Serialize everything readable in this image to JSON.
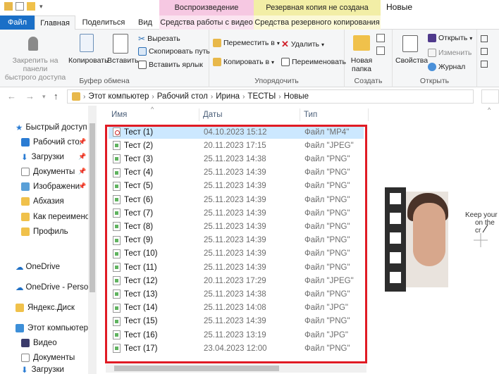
{
  "title_bar": {
    "window_title": "Новые",
    "context_play": "Воспроизведение",
    "context_backup": "Резервная копия не создана"
  },
  "tabs": [
    "Файл",
    "Главная",
    "Поделиться",
    "Вид",
    "Средства работы с видео",
    "Средства резервного копирования"
  ],
  "ribbon": {
    "pin": "Закрепить на панели быстрого доступа",
    "pin_l1": "Закрепить на панели",
    "pin_l2": "быстрого доступа",
    "copy": "Копировать",
    "paste": "Вставить",
    "cut": "Вырезать",
    "copy_path": "Скопировать путь",
    "paste_shortcut": "Вставить ярлык",
    "clipboard_group": "Буфер обмена",
    "move_to": "Переместить в",
    "copy_to": "Копировать в",
    "delete": "Удалить",
    "rename": "Переименовать",
    "organize_group": "Упорядочить",
    "new_folder_l1": "Новая",
    "new_folder_l2": "папка",
    "create_group": "Создать",
    "properties": "Свойства",
    "open": "Открыть",
    "edit": "Изменить",
    "history": "Журнал",
    "open_group": "Открыть"
  },
  "address": {
    "crumbs": [
      "Этот компьютер",
      "Рабочий стол",
      "Ирина",
      "ТЕСТЫ",
      "Новые"
    ]
  },
  "nav": [
    {
      "label": "Быстрый доступ",
      "pinned": false
    },
    {
      "label": "Рабочий сто.",
      "pinned": true
    },
    {
      "label": "Загрузки",
      "pinned": true
    },
    {
      "label": "Документы",
      "pinned": true
    },
    {
      "label": "Изображени",
      "pinned": true
    },
    {
      "label": "Абхазия",
      "pinned": false
    },
    {
      "label": "Как переимено",
      "pinned": false
    },
    {
      "label": "Профиль",
      "pinned": false
    },
    {
      "label": "OneDrive",
      "pinned": false
    },
    {
      "label": "OneDrive - Person",
      "pinned": false
    },
    {
      "label": "Яндекс.Диск",
      "pinned": false
    },
    {
      "label": "Этот компьютер",
      "pinned": false
    },
    {
      "label": "Видео",
      "pinned": false
    },
    {
      "label": "Документы",
      "pinned": false
    },
    {
      "label": "Загрузки",
      "pinned": false
    }
  ],
  "columns": {
    "name": "Имя",
    "date": "Даты",
    "type": "Тип"
  },
  "files": [
    {
      "name": "Тест (1)",
      "date": "04.10.2023 15:12",
      "type": "Файл \"MP4\"",
      "kind": "mp4",
      "selected": true
    },
    {
      "name": "Тест (2)",
      "date": "20.11.2023 17:15",
      "type": "Файл \"JPEG\"",
      "kind": "png",
      "selected": false
    },
    {
      "name": "Тест (3)",
      "date": "25.11.2023 14:38",
      "type": "Файл \"PNG\"",
      "kind": "png",
      "selected": false
    },
    {
      "name": "Тест (4)",
      "date": "25.11.2023 14:39",
      "type": "Файл \"PNG\"",
      "kind": "png",
      "selected": false
    },
    {
      "name": "Тест (5)",
      "date": "25.11.2023 14:39",
      "type": "Файл \"PNG\"",
      "kind": "png",
      "selected": false
    },
    {
      "name": "Тест (6)",
      "date": "25.11.2023 14:39",
      "type": "Файл \"PNG\"",
      "kind": "png",
      "selected": false
    },
    {
      "name": "Тест (7)",
      "date": "25.11.2023 14:39",
      "type": "Файл \"PNG\"",
      "kind": "png",
      "selected": false
    },
    {
      "name": "Тест (8)",
      "date": "25.11.2023 14:39",
      "type": "Файл \"PNG\"",
      "kind": "png",
      "selected": false
    },
    {
      "name": "Тест (9)",
      "date": "25.11.2023 14:39",
      "type": "Файл \"PNG\"",
      "kind": "png",
      "selected": false
    },
    {
      "name": "Тест (10)",
      "date": "25.11.2023 14:39",
      "type": "Файл \"PNG\"",
      "kind": "png",
      "selected": false
    },
    {
      "name": "Тест (11)",
      "date": "25.11.2023 14:39",
      "type": "Файл \"PNG\"",
      "kind": "png",
      "selected": false
    },
    {
      "name": "Тест (12)",
      "date": "20.11.2023 17:29",
      "type": "Файл \"JPEG\"",
      "kind": "png",
      "selected": false
    },
    {
      "name": "Тест (13)",
      "date": "25.11.2023 14:38",
      "type": "Файл \"PNG\"",
      "kind": "png",
      "selected": false
    },
    {
      "name": "Тест (14)",
      "date": "25.11.2023 14:08",
      "type": "Файл \"JPG\"",
      "kind": "png",
      "selected": false
    },
    {
      "name": "Тест (15)",
      "date": "25.11.2023 14:39",
      "type": "Файл \"PNG\"",
      "kind": "png",
      "selected": false
    },
    {
      "name": "Тест (16)",
      "date": "25.11.2023 13:19",
      "type": "Файл \"JPG\"",
      "kind": "png",
      "selected": false
    },
    {
      "name": "Тест (17)",
      "date": "23.04.2023 12:00",
      "type": "Файл \"PNG\"",
      "kind": "png",
      "selected": false
    }
  ],
  "preview": {
    "text_l1": "Keep your",
    "text_l2": "on the cr"
  },
  "colors": {
    "accent": "#1a6fc7",
    "highlight": "#e01b24",
    "selected": "#cce8ff"
  }
}
